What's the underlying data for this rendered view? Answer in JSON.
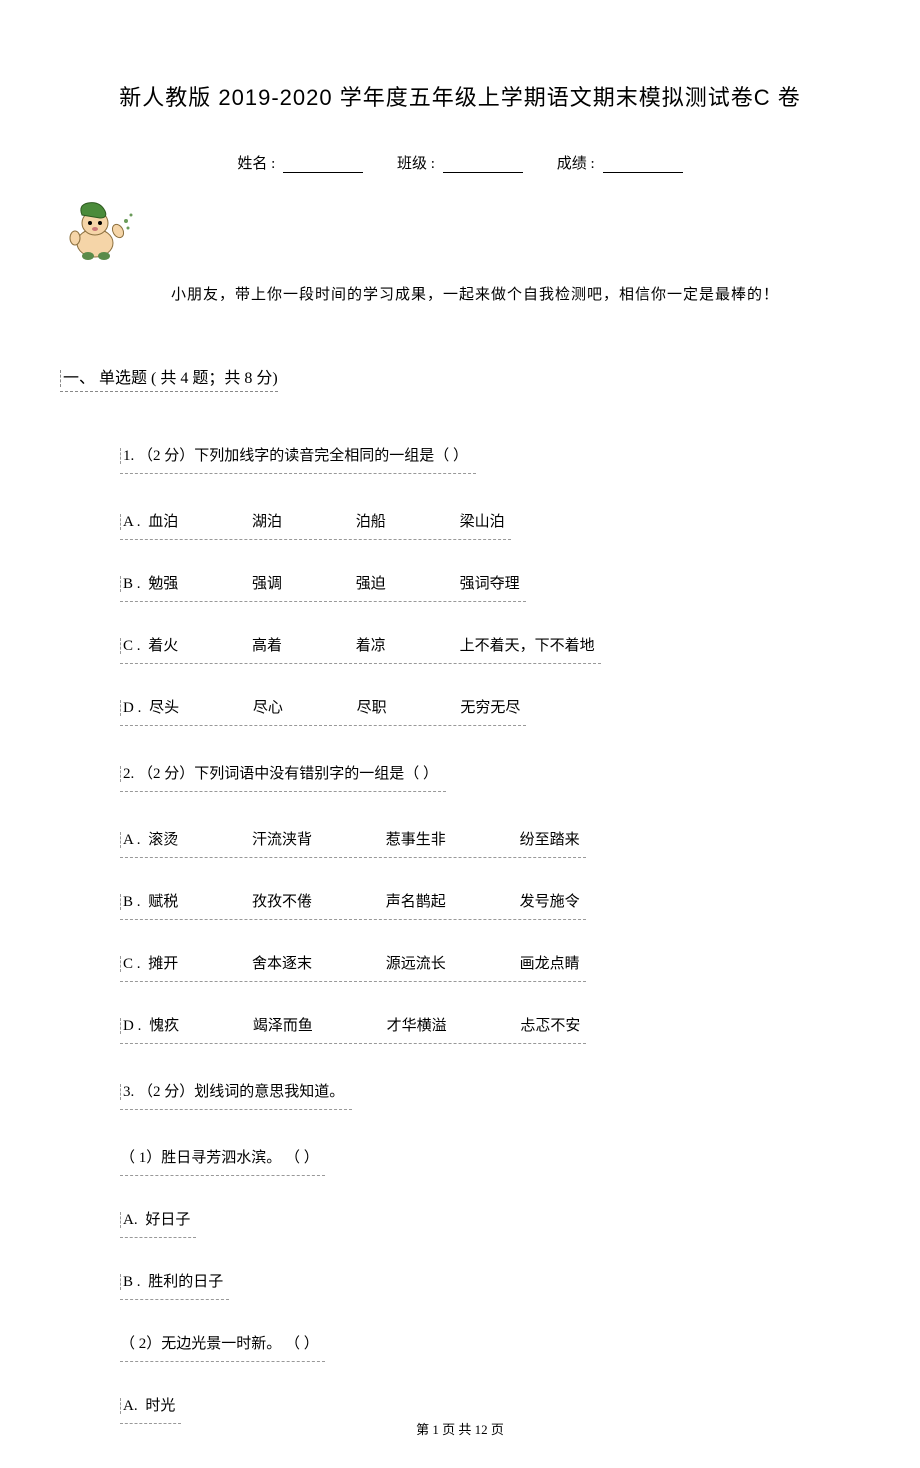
{
  "title": "新人教版 2019-2020 学年度五年级上学期语文期末模拟测试卷C 卷",
  "info": {
    "name_label": "姓名 :",
    "class_label": "班级 :",
    "score_label": "成绩 :"
  },
  "intro": "小朋友，带上你一段时间的学习成果，一起来做个自我检测吧，相信你一定是最棒的！",
  "section1": {
    "header": "一、 单选题 ( 共 4 题；共 8 分)",
    "q1": {
      "stem": "1.   （2 分）下列加线字的读音完全相同的一组是（         ）",
      "options": [
        {
          "letter": "A .",
          "words": [
            "血泊",
            "湖泊",
            "泊船",
            "梁山泊"
          ]
        },
        {
          "letter": "B .",
          "words": [
            "勉强",
            "强调",
            "强迫",
            "强词夺理"
          ]
        },
        {
          "letter": "C .",
          "words": [
            "着火",
            "高着",
            "着凉",
            "上不着天，下不着地"
          ]
        },
        {
          "letter": "D .",
          "words": [
            "尽头",
            "尽心",
            "尽职",
            "无穷无尽"
          ]
        }
      ]
    },
    "q2": {
      "stem": "2.   （2 分）下列词语中没有错别字的一组是（         ）",
      "options": [
        {
          "letter": "A .",
          "words": [
            "滚烫",
            "汗流浃背",
            "惹事生非",
            "纷至踏来"
          ]
        },
        {
          "letter": "B .",
          "words": [
            "赋税",
            "孜孜不倦",
            "声名鹊起",
            "发号施令"
          ]
        },
        {
          "letter": "C .",
          "words": [
            "摊开",
            "舍本逐末",
            "源远流长",
            "画龙点睛"
          ]
        },
        {
          "letter": "D .",
          "words": [
            "愧疚",
            "竭泽而鱼",
            "才华横溢",
            "忐忑不安"
          ]
        }
      ]
    },
    "q3": {
      "stem": "3.   （2 分）划线词的意思我知道。",
      "sub1": {
        "text": "（ 1）胜日寻芳泗水滨。 （      ）",
        "options": [
          {
            "letter": "A.",
            "text": "好日子"
          },
          {
            "letter": "B .",
            "text": "胜利的日子"
          }
        ]
      },
      "sub2": {
        "text": "（ 2）无边光景一时新。 （      ）",
        "options": [
          {
            "letter": "A.",
            "text": "时光"
          }
        ]
      }
    }
  },
  "footer": "第 1 页 共 12 页"
}
